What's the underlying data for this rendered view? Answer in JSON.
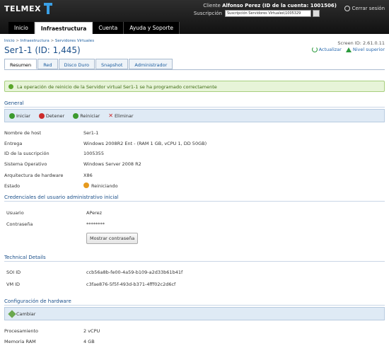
{
  "header": {
    "brand": "TELMEX",
    "client_label": "Cliente",
    "client_value": "Alfonso Perez (ID de la cuenta: 1001506)",
    "subscription_label": "Suscripción",
    "subscription_value": "Suscripción Servidores Virtuales\\1005329",
    "logout_label": "Cerrar sesión",
    "nav": [
      "Inicio",
      "Infraestructura",
      "Cuenta",
      "Ayuda y Soporte"
    ]
  },
  "breadcrumb": [
    "Inicio",
    "Infraestructura",
    "Servidores Virtuales"
  ],
  "page": {
    "title": "Ser1-1 (ID: 1,445)",
    "screen_id": "Screen ID:  2.61.0.11",
    "refresh_label": "Actualizar",
    "up_label": "Nivel superior"
  },
  "tabs": [
    "Resumen",
    "Red",
    "Disco Duro",
    "Snapshot",
    "Administrador"
  ],
  "success_message": "La operación de reinicio de la Servidor virtual Ser1-1 se ha programado correctamente",
  "general": {
    "title": "General",
    "actions": [
      "Iniciar",
      "Detener",
      "Reiniciar",
      "Eliminar"
    ],
    "fields": [
      {
        "label": "Nombre de host",
        "value": "Ser1-1"
      },
      {
        "label": "Entrega",
        "value": "Windows 2008R2 Ent - (RAM 1 GB, vCPU 1, DD 50GB)"
      },
      {
        "label": "ID de la suscripción",
        "value": "1005355"
      },
      {
        "label": "Sistema Operativo",
        "value": "Windows Server 2008 R2"
      },
      {
        "label": "Arquitectura de hardware",
        "value": "X86"
      },
      {
        "label": "Estado",
        "value": "Reiniciando"
      }
    ]
  },
  "credentials": {
    "title": "Credenciales del usuario administrativo inicial",
    "fields": [
      {
        "label": "Usuario",
        "value": "APerez"
      },
      {
        "label": "Contraseña",
        "value": "********"
      }
    ],
    "show_button": "Mostrar contraseña"
  },
  "technical": {
    "title": "Technical Details",
    "fields": [
      {
        "label": "SOI ID",
        "value": "ccb56a8b-fe00-4a59-b109-a2d33b61b41f"
      },
      {
        "label": "VM ID",
        "value": "c3fae876-5f5f-493d-b371-4fff02c2d6cf"
      }
    ]
  },
  "hardware": {
    "title": "Configuración de hardware",
    "action": "Cambiar",
    "fields": [
      {
        "label": "Procesamiento",
        "value": "2 vCPU"
      },
      {
        "label": "Memoria RAM",
        "value": "4 GB"
      }
    ]
  }
}
